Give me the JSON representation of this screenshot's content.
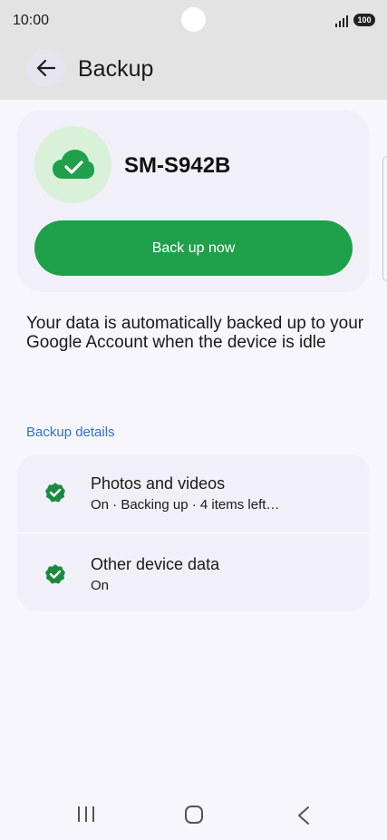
{
  "status": {
    "time": "10:00",
    "battery": "100"
  },
  "header": {
    "title": "Backup"
  },
  "device": {
    "name": "SM-S942B",
    "backup_button": "Back up now"
  },
  "info": {
    "text": "Your data is automatically backed up to your Google Account when the device is idle"
  },
  "details": {
    "section_title": "Backup details",
    "items": [
      {
        "title": "Photos and videos",
        "subtitle": "On · Backing up · 4 items left…"
      },
      {
        "title": "Other device data",
        "subtitle": "On"
      }
    ]
  },
  "colors": {
    "accent_green": "#1fa04b",
    "link_blue": "#2f72c6",
    "check_green": "#1b8a3f"
  }
}
